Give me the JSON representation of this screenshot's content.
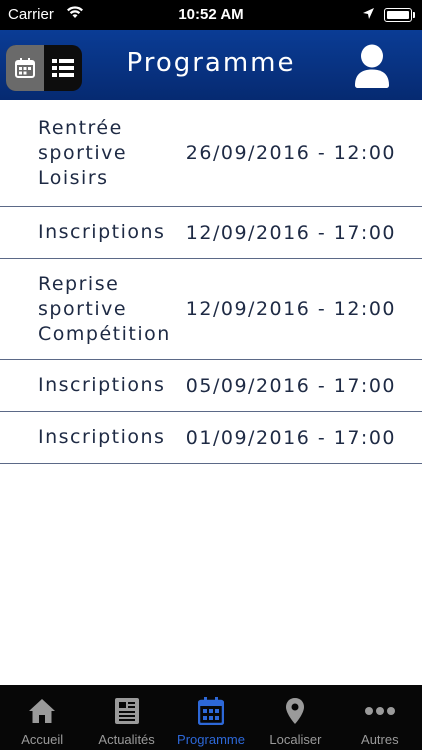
{
  "status_bar": {
    "carrier": "Carrier",
    "time": "10:52 AM"
  },
  "header": {
    "title": "Programme"
  },
  "events": [
    {
      "name": "Rentrée\nsportive\nLoisirs",
      "date": "26/09/2016 - 12:00"
    },
    {
      "name": "Inscriptions",
      "date": "12/09/2016 - 17:00"
    },
    {
      "name": "Reprise\nsportive\nCompétition",
      "date": "12/09/2016 - 12:00"
    },
    {
      "name": "Inscriptions",
      "date": "05/09/2016 - 17:00"
    },
    {
      "name": "Inscriptions",
      "date": "01/09/2016 - 17:00"
    }
  ],
  "tabbar": {
    "tabs": [
      {
        "label": "Accueil",
        "icon": "home-icon"
      },
      {
        "label": "Actualités",
        "icon": "news-icon"
      },
      {
        "label": "Programme",
        "icon": "calendar-icon",
        "active": true
      },
      {
        "label": "Localiser",
        "icon": "map-pin-icon"
      },
      {
        "label": "Autres",
        "icon": "more-icon"
      }
    ]
  },
  "colors": {
    "header": "#0a3c95",
    "text": "#1e2a44",
    "active_tab": "#2d68d8",
    "divider": "#5b6987"
  }
}
